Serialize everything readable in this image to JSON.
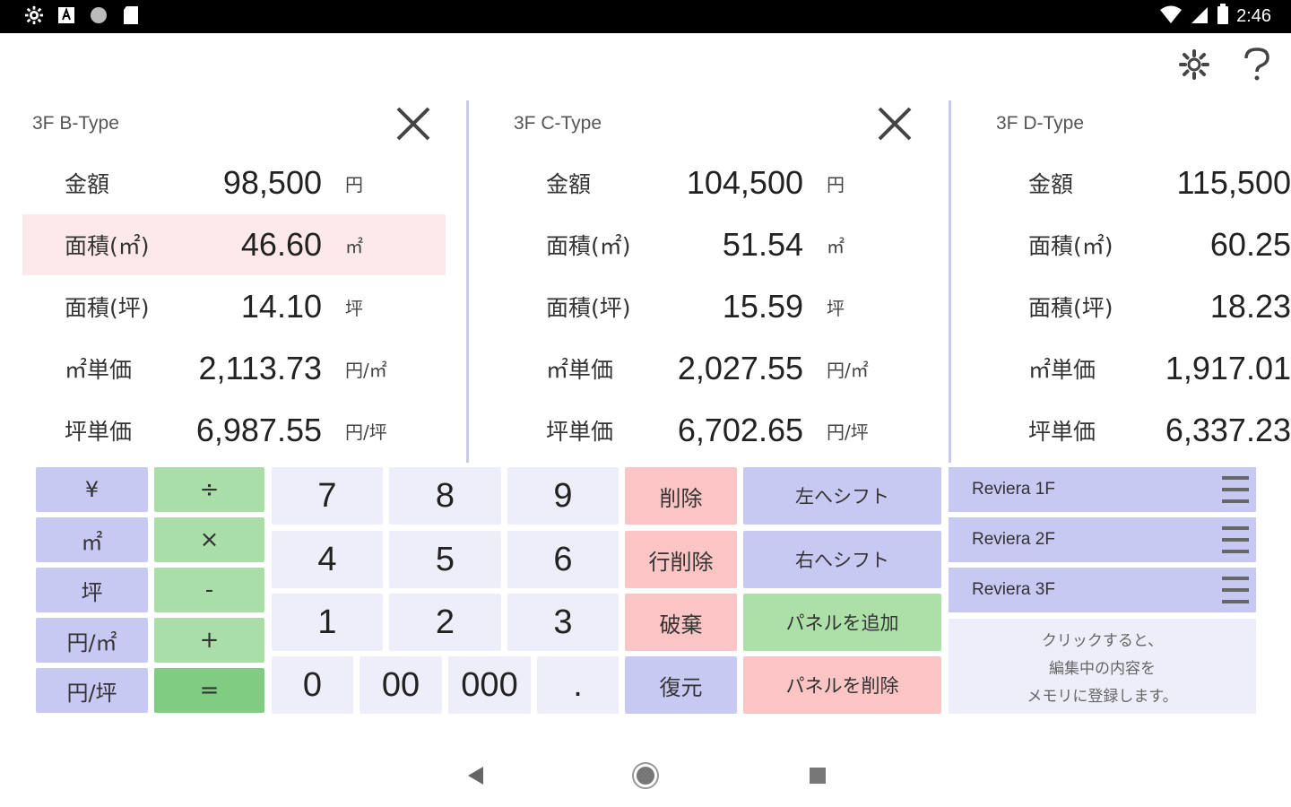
{
  "status_bar": {
    "time": "2:46",
    "left_icons": [
      "settings-icon",
      "font-icon",
      "circle-icon",
      "sd-card-icon"
    ],
    "right_icons": [
      "wifi-icon",
      "signal-icon",
      "battery-icon"
    ]
  },
  "app_bar": {
    "icons": [
      "gear-icon",
      "help-icon"
    ]
  },
  "panels": [
    {
      "title": "3F B-Type",
      "closable": true,
      "rows": [
        {
          "label": "金額",
          "value": "98,500",
          "unit": "円"
        },
        {
          "label": "面積(㎡)",
          "value": "46.60",
          "unit": "㎡",
          "highlighted": true
        },
        {
          "label": "面積(坪)",
          "value": "14.10",
          "unit": "坪"
        },
        {
          "label": "㎡単価",
          "value": "2,113.73",
          "unit": "円/㎡"
        },
        {
          "label": "坪単価",
          "value": "6,987.55",
          "unit": "円/坪"
        }
      ]
    },
    {
      "title": "3F C-Type",
      "closable": true,
      "rows": [
        {
          "label": "金額",
          "value": "104,500",
          "unit": "円"
        },
        {
          "label": "面積(㎡)",
          "value": "51.54",
          "unit": "㎡"
        },
        {
          "label": "面積(坪)",
          "value": "15.59",
          "unit": "坪"
        },
        {
          "label": "㎡単価",
          "value": "2,027.55",
          "unit": "円/㎡"
        },
        {
          "label": "坪単価",
          "value": "6,702.65",
          "unit": "円/坪"
        }
      ]
    },
    {
      "title": "3F D-Type",
      "closable": false,
      "rows": [
        {
          "label": "金額",
          "value": "115,500"
        },
        {
          "label": "面積(㎡)",
          "value": "60.25"
        },
        {
          "label": "面積(坪)",
          "value": "18.23"
        },
        {
          "label": "㎡単価",
          "value": "1,917.01"
        },
        {
          "label": "坪単価",
          "value": "6,337.23"
        }
      ]
    }
  ],
  "keypad": {
    "units": [
      "¥",
      "㎡",
      "坪",
      "円/㎡",
      "円/坪"
    ],
    "operators": [
      "÷",
      "×",
      "-",
      "+",
      "="
    ],
    "digits": {
      "k7": "7",
      "k8": "8",
      "k9": "9",
      "k4": "4",
      "k5": "5",
      "k6": "6",
      "k1": "1",
      "k2": "2",
      "k3": "3",
      "k0": "0",
      "k00": "00",
      "k000": "000",
      "dot": "."
    },
    "actions": {
      "delete": "削除",
      "delete_row": "行削除",
      "discard": "破棄",
      "restore": "復元",
      "shift_left": "左へシフト",
      "shift_right": "右へシフト",
      "add_panel": "パネルを追加",
      "remove_panel": "パネルを削除"
    }
  },
  "memory": {
    "items": [
      "Reviera 1F",
      "Reviera 2F",
      "Reviera 3F"
    ],
    "hint_lines": [
      "クリックすると、",
      "編集中の内容を",
      "メモリに登録します。"
    ]
  },
  "colors": {
    "unit_key": "#c7c9f2",
    "operator_key": "#a9dea9",
    "equals_key": "#7fcc82",
    "digit_key": "#eeeefb",
    "danger_key": "#fbc5c5",
    "highlight_row": "#fde9e9"
  }
}
